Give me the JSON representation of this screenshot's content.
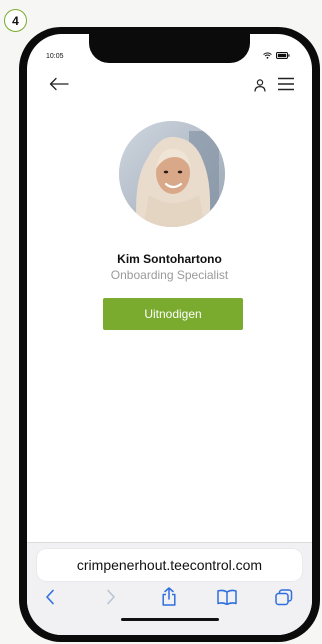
{
  "step": {
    "number": "4"
  },
  "status": {
    "time": "10:05"
  },
  "profile": {
    "name": "Kim Sontohartono",
    "role": "Onboarding Specialist"
  },
  "actions": {
    "invite_label": "Uitnodigen"
  },
  "browser": {
    "url": "crimpenerhout.teecontrol.com"
  },
  "icons": {
    "back": "arrow-left-icon",
    "user": "user-icon",
    "menu": "hamburger-menu-icon",
    "nav_back": "chevron-left-icon",
    "nav_forward": "chevron-right-icon",
    "share": "share-icon",
    "bookmarks": "book-icon",
    "tabs": "tabs-icon"
  },
  "colors": {
    "accent": "#7aab2e",
    "role_text": "#9a9a9a",
    "link_blue": "#2f6fde"
  }
}
